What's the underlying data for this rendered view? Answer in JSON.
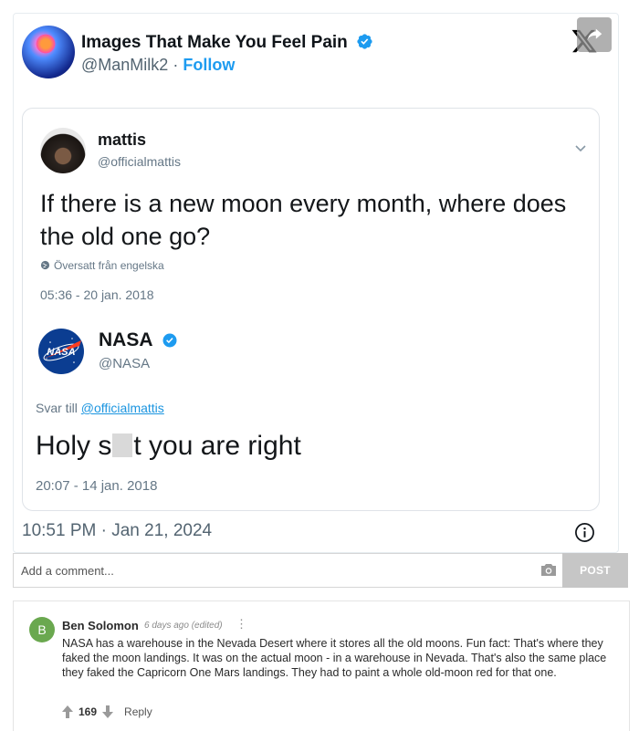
{
  "post": {
    "author_name": "Images That Make You Feel Pain",
    "handle": "@ManMilk2",
    "separator": "·",
    "follow_label": "Follow",
    "timestamp": "10:51 PM · Jan 21, 2024"
  },
  "quoted": {
    "original": {
      "name": "mattis",
      "handle": "@officialmattis",
      "text": "If there is a new moon every month, where does the old one go?",
      "translated_note": "Översatt från engelska",
      "time": "05:36 - 20 jan. 2018"
    },
    "reply": {
      "name": "NASA",
      "handle": "@NASA",
      "logo_text": "NASA",
      "reply_prefix": "Svar till",
      "reply_to": "@officialmattis",
      "text_start": "Holy s",
      "text_end": "t you are right",
      "time": "20:07 - 14 jan. 2018"
    }
  },
  "comment_form": {
    "placeholder": "Add a comment...",
    "post_label": "POST"
  },
  "comment": {
    "avatar_letter": "B",
    "author": "Ben Solomon",
    "meta": "6 days ago (edited)",
    "menu_glyph": "⋮",
    "body": "NASA has a warehouse in the Nevada Desert where it stores all the old moons. Fun fact: That's where they faked the moon landings. It was on the actual moon - in a warehouse in Nevada. That's also the same place they faked the Capricorn One Mars landings. They had to paint a whole old-moon red for that one.",
    "votes": "169",
    "reply_label": "Reply"
  },
  "colors": {
    "accent": "#1d9bf0",
    "verified": "#1d9bf0",
    "nasa_blue": "#0b3d91",
    "nasa_red": "#fc3d21",
    "commenter_avatar": "#6aa84f"
  },
  "icons": {
    "verified": "verified-badge-icon",
    "x_logo": "x-logo-icon",
    "share": "share-icon",
    "chevron": "chevron-down-icon",
    "globe": "globe-icon",
    "info": "info-icon",
    "camera": "camera-icon",
    "upvote": "upvote-arrow-icon",
    "downvote": "downvote-arrow-icon"
  }
}
